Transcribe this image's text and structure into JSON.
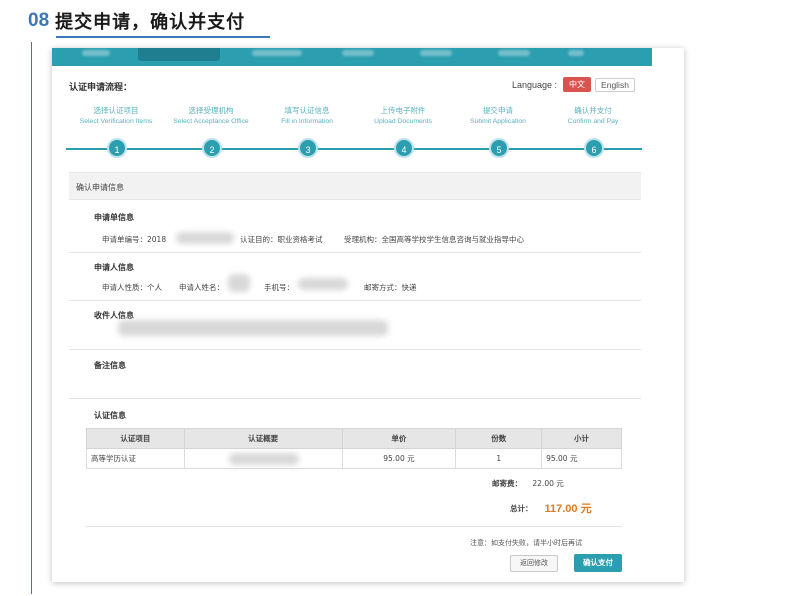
{
  "article": {
    "step_number": "08",
    "step_title": "提交申请，确认并支付"
  },
  "flow": {
    "title": "认证申请流程：",
    "language_label": "Language :",
    "lang_zh": "中文",
    "lang_en": "English",
    "steps": [
      {
        "zh": "选择认证项目",
        "en": "Select Verification Items",
        "num": "1"
      },
      {
        "zh": "选择受理机构",
        "en": "Select Acceptance Office",
        "num": "2"
      },
      {
        "zh": "填写认证信息",
        "en": "Fill in Information",
        "num": "3"
      },
      {
        "zh": "上传电子附件",
        "en": "Upload Documents",
        "num": "4"
      },
      {
        "zh": "提交申请",
        "en": "Submit Application",
        "num": "5"
      },
      {
        "zh": "确认并支付",
        "en": "Confirm and Pay",
        "num": "6"
      }
    ]
  },
  "confirm": {
    "section_title": "确认申请信息",
    "application": {
      "title": "申请单信息",
      "number_label": "申请单编号：2018",
      "purpose": "认证目的：职业资格考试",
      "office": "受理机构：全国高等学校学生信息咨询与就业指导中心"
    },
    "applicant": {
      "title": "申请人信息",
      "type": "申请人性质：个人",
      "name_label": "申请人姓名：",
      "phone_label": "手机号：",
      "mail_method": "邮寄方式：快递"
    },
    "recipient": {
      "title": "收件人信息"
    },
    "remarks": {
      "title": "备注信息"
    },
    "certification": {
      "title": "认证信息",
      "headers": [
        "认证项目",
        "认证概要",
        "单价",
        "份数",
        "小计"
      ],
      "rows": [
        {
          "item": "高等学历认证",
          "summary": "",
          "price": "95.00 元",
          "qty": "1",
          "subtotal": "95.00 元"
        }
      ]
    },
    "postage_label": "邮寄费：",
    "postage_value": "22.00 元",
    "total_label": "总计：",
    "total_value": "117.00 元",
    "note": "注意：如支付失败，请半小时后再试",
    "back_button": "返回修改",
    "pay_button": "确认支付"
  }
}
